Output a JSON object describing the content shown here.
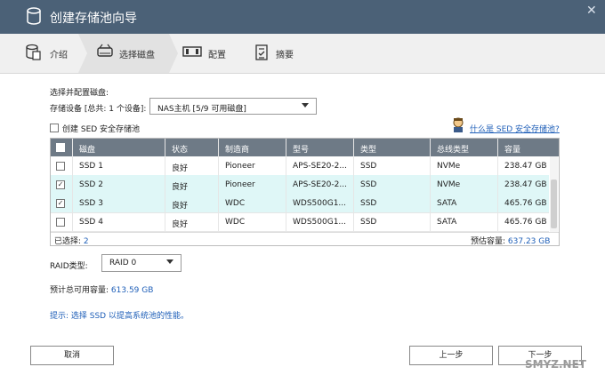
{
  "window": {
    "title": "创建存储池向导"
  },
  "steps": [
    {
      "label": "介绍"
    },
    {
      "label": "选择磁盘"
    },
    {
      "label": "配置"
    },
    {
      "label": "摘要"
    }
  ],
  "section_title": "选择并配置磁盘:",
  "device": {
    "label": "存储设备 [总共: 1 个设备]:",
    "value": "NAS主机 [5/9 可用磁盘]"
  },
  "sed_checkbox_label": "创建 SED 安全存储池",
  "sed_link": "什么是 SED 安全存储池?",
  "table": {
    "columns": [
      "磁盘",
      "状态",
      "制造商",
      "型号",
      "类型",
      "总线类型",
      "容量"
    ],
    "rows": [
      {
        "checked": false,
        "selected": false,
        "disk": "SSD 1",
        "status": "良好",
        "vendor": "Pioneer",
        "model": "APS-SE20-2...",
        "type": "SSD",
        "bus": "NVMe",
        "capacity": "238.47 GB"
      },
      {
        "checked": true,
        "selected": true,
        "disk": "SSD 2",
        "status": "良好",
        "vendor": "Pioneer",
        "model": "APS-SE20-2...",
        "type": "SSD",
        "bus": "NVMe",
        "capacity": "238.47 GB"
      },
      {
        "checked": true,
        "selected": true,
        "disk": "SSD 3",
        "status": "良好",
        "vendor": "WDC",
        "model": "WDS500G1...",
        "type": "SSD",
        "bus": "SATA",
        "capacity": "465.76 GB"
      },
      {
        "checked": false,
        "selected": false,
        "disk": "SSD 4",
        "status": "良好",
        "vendor": "WDC",
        "model": "WDS500G1...",
        "type": "SSD",
        "bus": "SATA",
        "capacity": "465.76 GB"
      }
    ],
    "selected_label": "已选择:",
    "selected_count": "2",
    "estimated_label": "预估容量:",
    "estimated_value": "637.23 GB"
  },
  "raid": {
    "label": "RAID类型:",
    "value": "RAID 0"
  },
  "usable": {
    "label": "预计总可用容量:",
    "value": "613.59 GB"
  },
  "hint": "提示: 选择 SSD 以提高系统池的性能。",
  "buttons": {
    "cancel": "取消",
    "prev": "上一步",
    "next": "下一步"
  },
  "watermark": "SMYZ.NET",
  "colors": {
    "titlebar": "#4b6177",
    "link": "#1f5fb8",
    "selected_row": "#dff7f7",
    "table_header": "#6e7a86"
  }
}
